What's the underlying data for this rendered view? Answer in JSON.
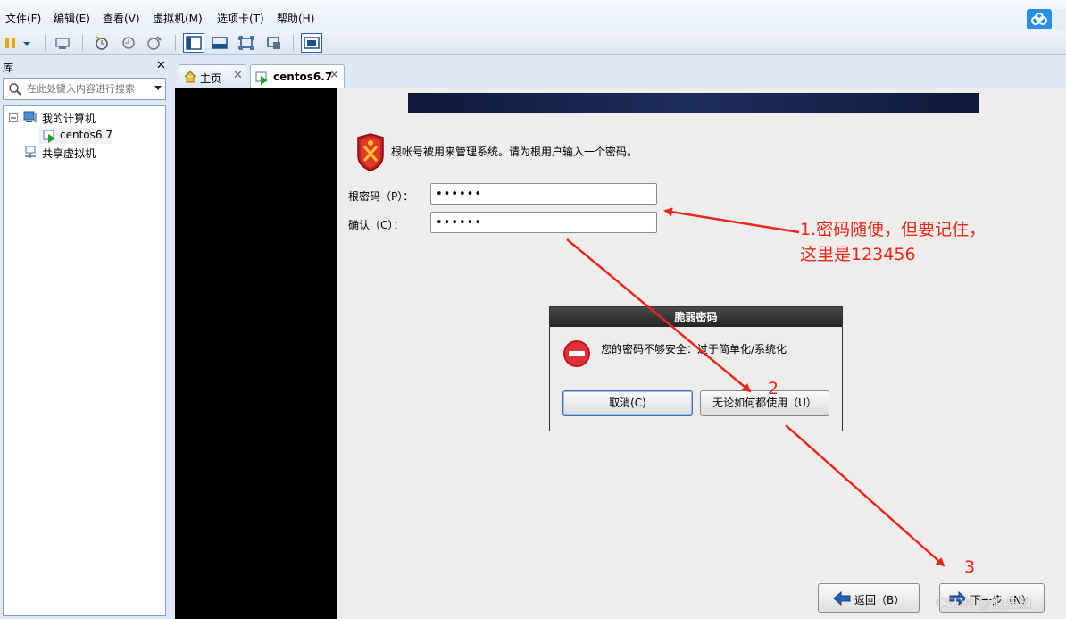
{
  "menubar": {
    "items": [
      "文件(F)",
      "编辑(E)",
      "查看(V)",
      "虚拟机(M)",
      "选项卡(T)",
      "帮助(H)"
    ]
  },
  "toolbar": {
    "icons": [
      "pause-icon",
      "dropdown-icon",
      "network-icon",
      "snapshot-icon",
      "revert-icon",
      "snapshot-manager-icon",
      "normal-view-icon",
      "console-view-icon",
      "fullscreen-icon",
      "unity-icon",
      "thumbnail-icon"
    ]
  },
  "library": {
    "title": "库",
    "search_placeholder": "在此处键入内容进行搜索",
    "tree": {
      "my_computer": "我的计算机",
      "vm": "centos6.7",
      "shared": "共享虚拟机"
    }
  },
  "tabs": [
    {
      "label": "主页"
    },
    {
      "label": "centos6.7"
    }
  ],
  "installer": {
    "instruction": "根帐号被用来管理系统。请为根用户输入一个密码。",
    "root_password_label": "根密码（P）：",
    "confirm_label": "确认（C）：",
    "password_value": "••••••",
    "confirm_value": "••••••",
    "back_label": "返回（B）",
    "next_label": "下一步（N）"
  },
  "dialog": {
    "title": "脆弱密码",
    "message": "您的密码不够安全：过于简单化/系统化",
    "cancel_label": "取消(C)",
    "use_anyway_label": "无论如何都使用（U）"
  },
  "annotations": {
    "note1_line1": "1.密码随便，但要记住，",
    "note1_line2": "这里是123456",
    "step2": "2",
    "step3": "3",
    "color": "#e8281a"
  },
  "watermark": "CSDN @伯先知"
}
